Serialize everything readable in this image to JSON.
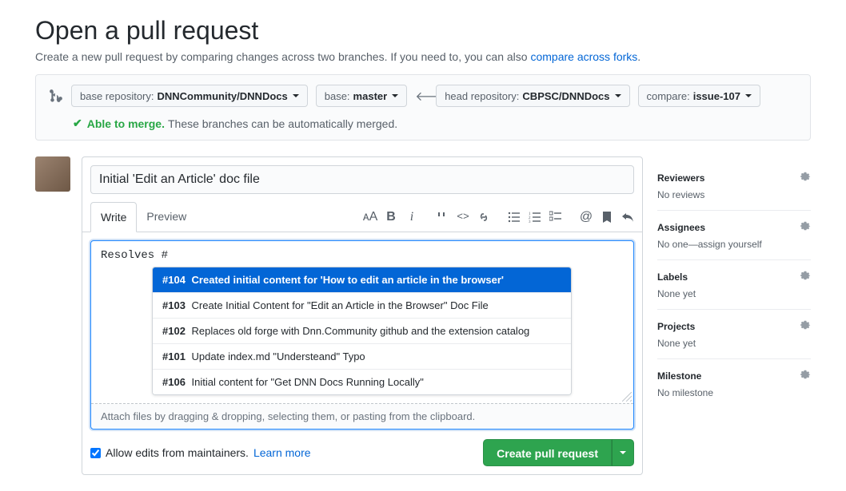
{
  "header": {
    "title": "Open a pull request",
    "subtitle_pre": "Create a new pull request by comparing changes across two branches. If you need to, you can also ",
    "subtitle_link": "compare across forks",
    "subtitle_post": "."
  },
  "compare": {
    "base_repo_label": "base repository: ",
    "base_repo": "DNNCommunity/DNNDocs",
    "base_branch_label": "base: ",
    "base_branch": "master",
    "head_repo_label": "head repository: ",
    "head_repo": "CBPSC/DNNDocs",
    "compare_label": "compare: ",
    "compare_branch": "issue-107"
  },
  "merge": {
    "able": "Able to merge.",
    "msg": "These branches can be automatically merged."
  },
  "editor": {
    "title": "Initial 'Edit an Article' doc file",
    "write_tab": "Write",
    "preview_tab": "Preview",
    "body": "Resolves #",
    "attach_hint": "Attach files by dragging & dropping, selecting them, or pasting from the clipboard.",
    "suggestions": [
      {
        "num": "#104",
        "text": "Created initial content for 'How to edit an article in the browser'"
      },
      {
        "num": "#103",
        "text": "Create Initial Content for \"Edit an Article in the Browser\" Doc File"
      },
      {
        "num": "#102",
        "text": "Replaces old forge with Dnn.Community github and the extension catalog"
      },
      {
        "num": "#101",
        "text": "Update index.md \"Understeand\" Typo"
      },
      {
        "num": "#106",
        "text": "Initial content for \"Get DNN Docs Running Locally\""
      }
    ]
  },
  "submit": {
    "allow_edits": "Allow edits from maintainers.",
    "learn_more": "Learn more",
    "create_btn": "Create pull request"
  },
  "sidebar": {
    "reviewers_title": "Reviewers",
    "reviewers_value": "No reviews",
    "assignees_title": "Assignees",
    "assignees_value_pre": "No one—",
    "assignees_value_link": "assign yourself",
    "labels_title": "Labels",
    "labels_value": "None yet",
    "projects_title": "Projects",
    "projects_value": "None yet",
    "milestone_title": "Milestone",
    "milestone_value": "No milestone"
  }
}
